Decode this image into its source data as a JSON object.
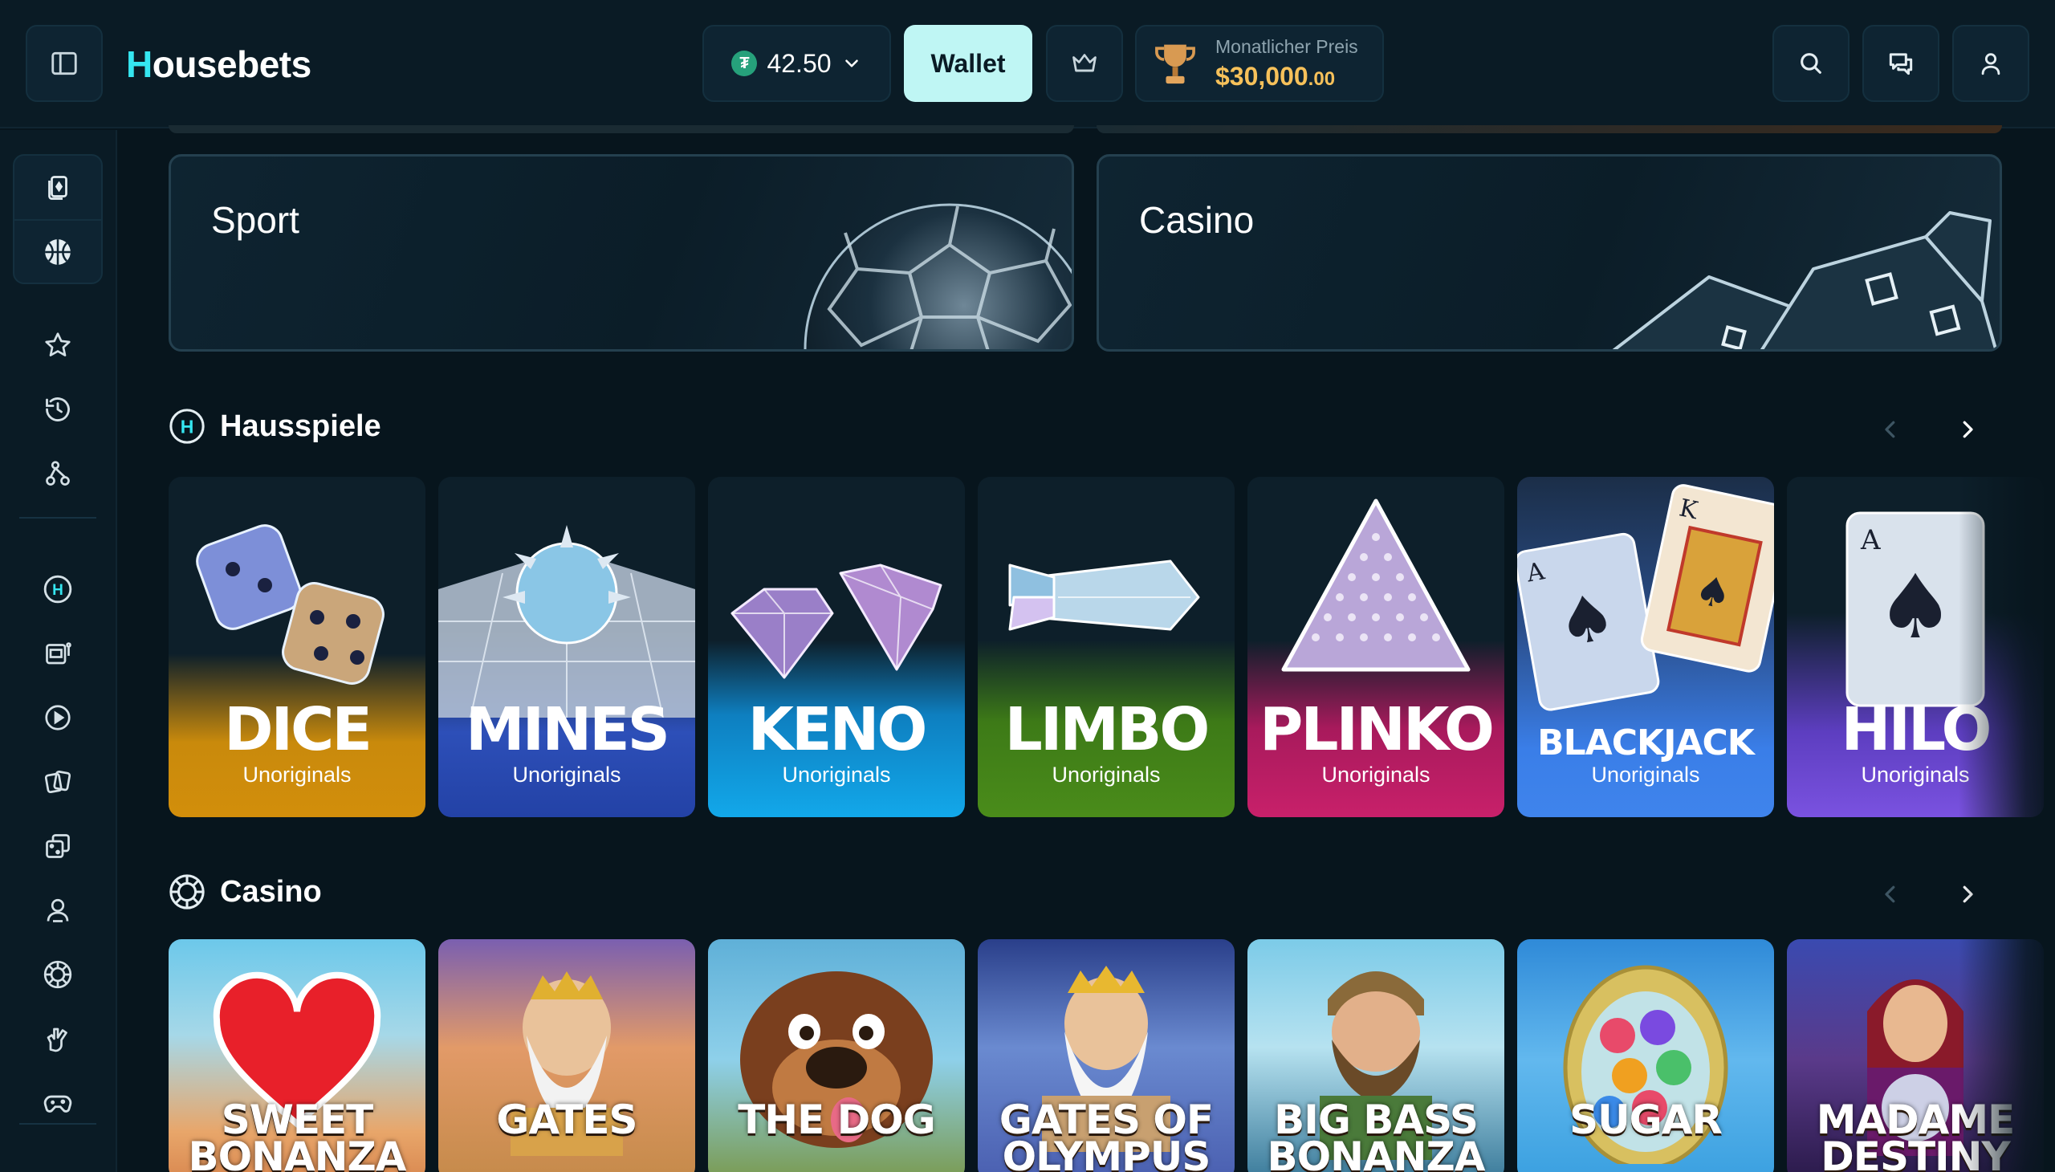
{
  "header": {
    "logo_first_letter": "H",
    "logo_rest": "ousebets",
    "balance": "42.50",
    "currency_icon": "tether-coin-icon",
    "wallet_label": "Wallet",
    "prize_label": "Monatlicher Preis",
    "prize_amount": "$30,000",
    "prize_cents": ".00"
  },
  "banners": {
    "sport_label": "Sport",
    "casino_label": "Casino"
  },
  "sidebar": {
    "group": [
      "casino-cards-icon",
      "basketball-icon"
    ],
    "items": [
      "star-icon",
      "history-icon",
      "recent-icon",
      "house-games-icon",
      "slots-icon",
      "live-play-icon",
      "table-cards-icon",
      "dice-icon",
      "live-dealer-icon",
      "roulette-icon",
      "poker-hand-icon",
      "gamepad-icon"
    ]
  },
  "sections": {
    "house_title": "Hausspiele",
    "casino_title": "Casino"
  },
  "house_games": [
    {
      "title": "DICE",
      "subtitle": "Unoriginals",
      "color": "#c98a0c"
    },
    {
      "title": "MINES",
      "subtitle": "Unoriginals",
      "color": "#2342a6"
    },
    {
      "title": "KENO",
      "subtitle": "Unoriginals",
      "color": "#12a3e6"
    },
    {
      "title": "LIMBO",
      "subtitle": "Unoriginals",
      "color": "#4a8c1a"
    },
    {
      "title": "PLINKO",
      "subtitle": "Unoriginals",
      "color": "#c8206a"
    },
    {
      "title": "BLACKJACK",
      "subtitle": "Unoriginals",
      "color": "#3a7ee8"
    },
    {
      "title": "HILO",
      "subtitle": "Unoriginals",
      "color": "#7a52e0"
    }
  ],
  "casino_games": [
    {
      "title": "SWEET BONANZA",
      "color": "#e8a66a"
    },
    {
      "title": "GATES",
      "color": "#c58a4a"
    },
    {
      "title": "THE DOG",
      "color": "#5fb0d8"
    },
    {
      "title": "GATES OF OLYMPUS",
      "color": "#4a5fb0"
    },
    {
      "title": "BIG BASS BONANZA",
      "color": "#6cc0e0"
    },
    {
      "title": "SUGAR",
      "color": "#3aa0e0"
    },
    {
      "title": "MADAME DESTINY",
      "color": "#5a3a8a"
    }
  ]
}
